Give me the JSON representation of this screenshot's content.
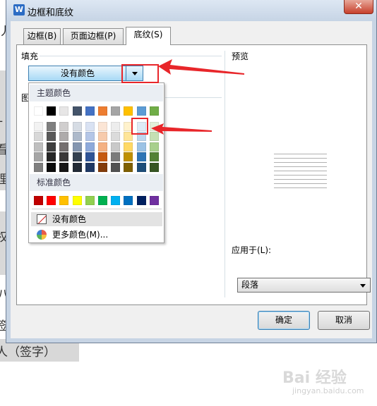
{
  "window": {
    "title": "边框和底纹",
    "close_glyph": "✕",
    "app_icon_letter": "W"
  },
  "tabs": [
    {
      "label": "边框(B)",
      "active": false
    },
    {
      "label": "页面边框(P)",
      "active": false
    },
    {
      "label": "底纹(S)",
      "active": true
    }
  ],
  "fill": {
    "section_label": "填充",
    "selected_value": "没有颜色"
  },
  "pattern": {
    "section_label_partial": "图"
  },
  "preview": {
    "label": "预览"
  },
  "apply_to": {
    "label": "应用于(L):",
    "value": "段落"
  },
  "buttons": {
    "ok": "确定",
    "cancel": "取消"
  },
  "color_popup": {
    "theme_header": "主题颜色",
    "standard_header": "标准颜色",
    "no_color": "没有颜色",
    "more_colors": "更多颜色(M)...",
    "theme_colors": [
      [
        "#ffffff",
        "#000000",
        "#e7e6e6",
        "#44546a",
        "#4472c4",
        "#ed7d31",
        "#a5a5a5",
        "#ffc000",
        "#5b9bd5",
        "#70ad47"
      ],
      [
        "#f2f2f2",
        "#7f7f7f",
        "#d0cece",
        "#d6dce4",
        "#d9e2f3",
        "#fbe5d5",
        "#ededed",
        "#fff2cc",
        "#deebf6",
        "#e2efd9"
      ],
      [
        "#d8d8d8",
        "#595959",
        "#aeabab",
        "#adb9ca",
        "#b4c6e7",
        "#f7cbac",
        "#dbdbdb",
        "#fee599",
        "#bdd7ee",
        "#c5e0b3"
      ],
      [
        "#bfbfbf",
        "#3f3f3f",
        "#757070",
        "#8496b0",
        "#8eaadb",
        "#f4b183",
        "#c9c9c9",
        "#ffd965",
        "#9cc3e5",
        "#a8d08d"
      ],
      [
        "#a5a5a5",
        "#262626",
        "#3a3838",
        "#323f4f",
        "#2f5496",
        "#c55a11",
        "#7b7b7b",
        "#bf9000",
        "#2e75b5",
        "#538135"
      ],
      [
        "#7f7f7f",
        "#0c0c0c",
        "#171616",
        "#222a35",
        "#1f3864",
        "#833c0b",
        "#525252",
        "#7f6000",
        "#1e4e79",
        "#375623"
      ]
    ],
    "standard_colors": [
      "#c00000",
      "#ff0000",
      "#ffc000",
      "#ffff00",
      "#92d050",
      "#00b050",
      "#00b0f0",
      "#0070c0",
      "#002060",
      "#7030a0"
    ]
  },
  "background": {
    "side_chars": [
      "丿",
      "-",
      "看",
      "理",
      "权",
      "八",
      "签"
    ],
    "bottom_text": "人（签字）"
  },
  "watermark": {
    "brand": "Bai 经验",
    "url": "jingyan.baidu.com"
  }
}
